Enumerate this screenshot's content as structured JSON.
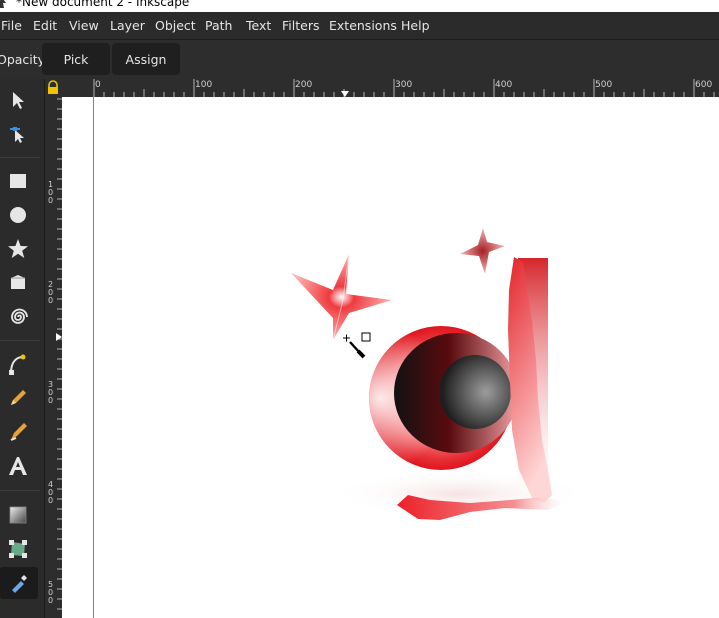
{
  "window": {
    "title": "*New document 2 - Inkscape"
  },
  "menu": [
    "File",
    "Edit",
    "View",
    "Layer",
    "Object",
    "Path",
    "Text",
    "Filters",
    "Extensions",
    "Help"
  ],
  "tool_controls": {
    "opacity_label": "Opacity:",
    "pick_label": "Pick",
    "assign_label": "Assign"
  },
  "rulers": {
    "horizontal": [
      "0",
      "100",
      "200",
      "300",
      "400",
      "500",
      "600"
    ],
    "vertical": [
      "1\n0\n0",
      "2\n0\n0",
      "3\n0\n0",
      "4\n0\n0",
      "5\n0\n0"
    ]
  },
  "toolbox": {
    "active_tool": "dropper-tool",
    "tools": [
      "selector",
      "node",
      "rectangle",
      "ellipse",
      "star",
      "3d-box",
      "spiral",
      "pen",
      "pencil",
      "calligraphy",
      "text",
      "gradient",
      "mesh",
      "dropper"
    ]
  },
  "colors": {
    "menubar_bg": "#2b2b2b",
    "ui_text": "#e6e6e6",
    "art_red": "#e8202a"
  }
}
